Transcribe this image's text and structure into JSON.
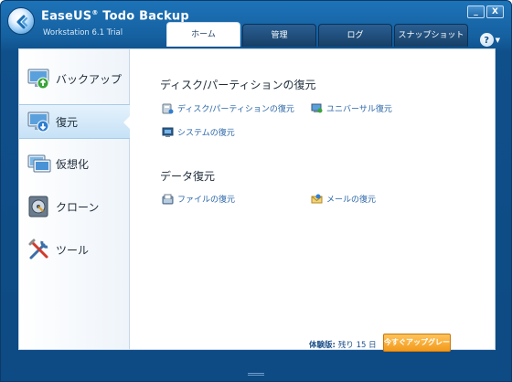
{
  "window": {
    "brand": "EaseUS",
    "brand_mark": "®",
    "product": "Todo Backup",
    "edition": "Workstation 6.1 Trial",
    "minimize_glyph": "_",
    "close_glyph": "X",
    "help_glyph": "?",
    "help_caret": "▼"
  },
  "tabs": [
    {
      "label": "ホーム",
      "active": true
    },
    {
      "label": "管理",
      "active": false
    },
    {
      "label": "ログ",
      "active": false
    },
    {
      "label": "スナップショット",
      "active": false
    }
  ],
  "sidebar": {
    "items": [
      {
        "label": "バックアップ",
        "icon": "backup-icon",
        "active": false
      },
      {
        "label": "復元",
        "icon": "restore-icon",
        "active": true
      },
      {
        "label": "仮想化",
        "icon": "virtualize-icon",
        "active": false
      },
      {
        "label": "クローン",
        "icon": "clone-icon",
        "active": false
      },
      {
        "label": "ツール",
        "icon": "tools-icon",
        "active": false
      }
    ]
  },
  "main": {
    "disk_section": {
      "title": "ディスク/パーティションの復元",
      "links": [
        {
          "label": "ディスク/パーティションの復元",
          "icon": "disk-partition-icon"
        },
        {
          "label": "ユニバーサル復元",
          "icon": "universal-restore-icon"
        },
        {
          "label": "システムの復元",
          "icon": "system-restore-icon"
        }
      ]
    },
    "data_section": {
      "title": "データ復元",
      "links": [
        {
          "label": "ファイルの復元",
          "icon": "file-restore-icon"
        },
        {
          "label": "メールの復元",
          "icon": "mail-restore-icon"
        }
      ]
    }
  },
  "footer": {
    "trial_label": "体験版:",
    "trial_remaining": "残り 15 日",
    "upgrade_label": "今すぐアップグレード"
  },
  "colors": {
    "title_bar": "#1d73b8",
    "link": "#2a66a8",
    "upgrade": "#f29a1c"
  }
}
